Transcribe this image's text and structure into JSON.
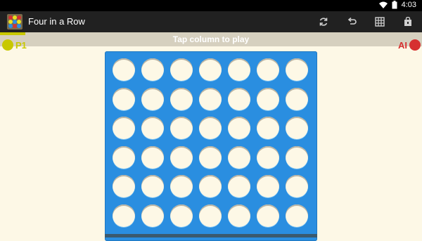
{
  "status_bar": {
    "time": "4:03",
    "icons": [
      "wifi-icon",
      "battery-icon"
    ]
  },
  "action_bar": {
    "app_title": "Four in a Row",
    "actions": [
      {
        "name": "restart-button",
        "icon": "refresh-icon"
      },
      {
        "name": "undo-button",
        "icon": "undo-icon"
      },
      {
        "name": "board-size-button",
        "icon": "grid-icon"
      },
      {
        "name": "store-button",
        "icon": "shopping-bag-icon"
      }
    ]
  },
  "game": {
    "turn_message": "Tap column to play",
    "player1": {
      "label": "P1",
      "color": "#c8c800"
    },
    "player2": {
      "label": "AI",
      "color": "#d63030"
    },
    "board": {
      "columns": 7,
      "rows": 6,
      "board_color": "#2a8ee0",
      "empty_color": "#fdf8e6"
    }
  }
}
